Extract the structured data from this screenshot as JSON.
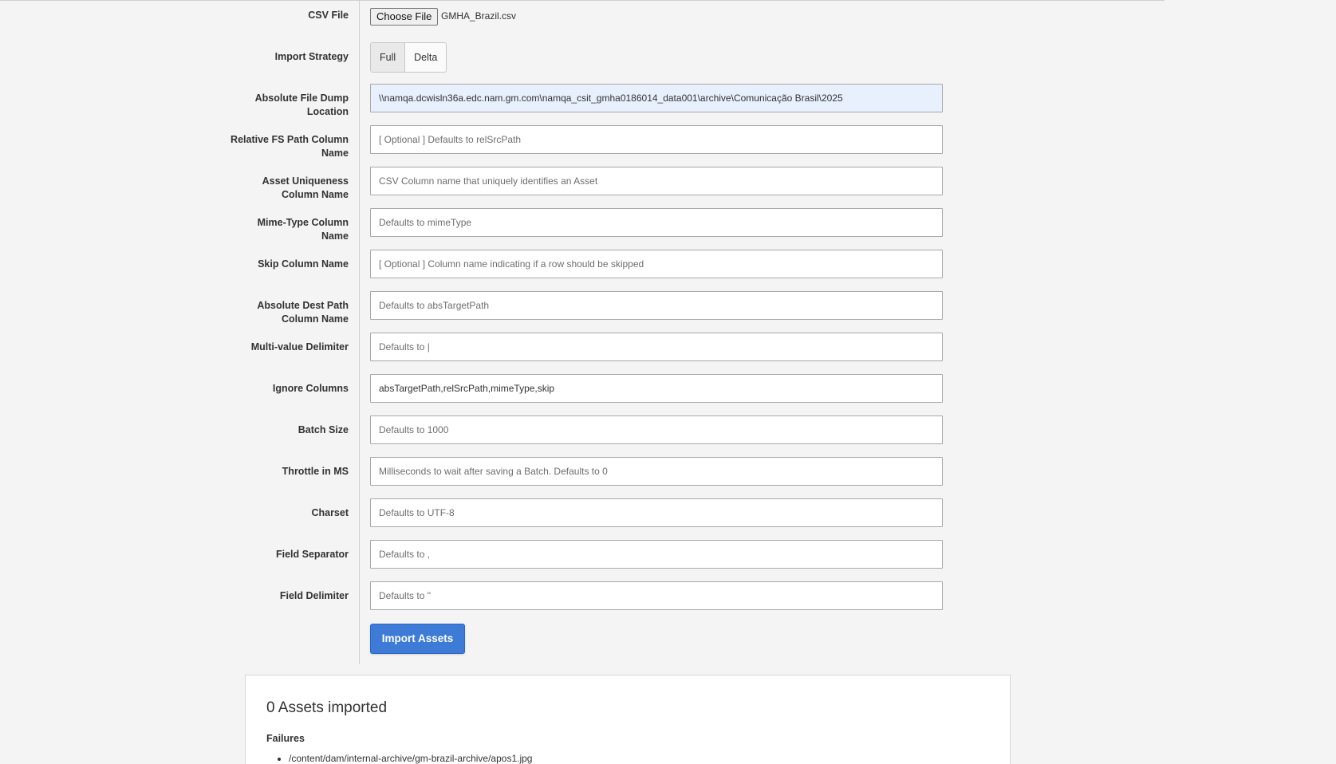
{
  "form": {
    "csv_file": {
      "label": "CSV File",
      "button_label": "Choose File",
      "file_name": "GMHA_Brazil.csv"
    },
    "import_strategy": {
      "label": "Import Strategy",
      "options": [
        "Full",
        "Delta"
      ],
      "selected": "Full"
    },
    "absolute_file_dump_location": {
      "label": "Absolute File Dump Location",
      "value": "\\\\namqa.dcwisln36a.edc.nam.gm.com\\namqa_csit_gmha0186014_data001\\archive\\Comunicação Brasil\\2025",
      "placeholder": ""
    },
    "relative_fs_path_column": {
      "label": "Relative FS Path Column Name",
      "value": "",
      "placeholder": "[ Optional ] Defaults to relSrcPath"
    },
    "asset_uniqueness_column": {
      "label": "Asset Uniqueness Column Name",
      "value": "",
      "placeholder": "CSV Column name that uniquely identifies an Asset"
    },
    "mime_type_column": {
      "label": "Mime-Type Column Name",
      "value": "",
      "placeholder": "Defaults to mimeType"
    },
    "skip_column": {
      "label": "Skip Column Name",
      "value": "",
      "placeholder": "[ Optional ] Column name indicating if a row should be skipped"
    },
    "absolute_dest_path_column": {
      "label": "Absolute Dest Path Column Name",
      "value": "",
      "placeholder": "Defaults to absTargetPath"
    },
    "multi_value_delimiter": {
      "label": "Multi-value Delimiter",
      "value": "",
      "placeholder": "Defaults to |"
    },
    "ignore_columns": {
      "label": "Ignore Columns",
      "value": "absTargetPath,relSrcPath,mimeType,skip",
      "placeholder": ""
    },
    "batch_size": {
      "label": "Batch Size",
      "value": "",
      "placeholder": "Defaults to 1000"
    },
    "throttle": {
      "label": "Throttle in MS",
      "value": "",
      "placeholder": "Milliseconds to wait after saving a Batch. Defaults to 0"
    },
    "charset": {
      "label": "Charset",
      "value": "",
      "placeholder": "Defaults to UTF-8"
    },
    "field_separator": {
      "label": "Field Separator",
      "value": "",
      "placeholder": "Defaults to ,"
    },
    "field_delimiter": {
      "label": "Field Delimiter",
      "value": "",
      "placeholder": "Defaults to \""
    },
    "submit_label": "Import Assets"
  },
  "results": {
    "title": "0 Assets imported",
    "failures_label": "Failures",
    "failures": [
      "/content/dam/internal-archive/gm-brazil-archive/apos1.jpg"
    ]
  },
  "colors": {
    "primary_button": "#3d7bd6",
    "page_background": "#f4f4f4",
    "autofill_background": "#e8f0fe"
  }
}
